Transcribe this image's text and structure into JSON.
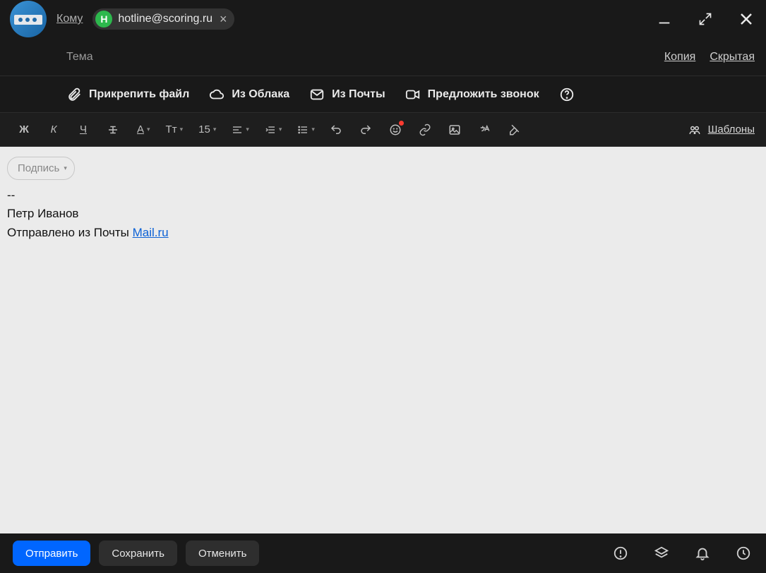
{
  "header": {
    "to_label": "Кому",
    "recipient": {
      "initial": "Н",
      "email": "hotline@scoring.ru"
    }
  },
  "subject": {
    "placeholder": "Тема",
    "cc_label": "Копия",
    "bcc_label": "Скрытая"
  },
  "attach": {
    "file": "Прикрепить файл",
    "cloud": "Из Облака",
    "mail": "Из Почты",
    "call": "Предложить звонок"
  },
  "toolbar": {
    "font_size": "15",
    "templates": "Шаблоны"
  },
  "editor": {
    "signature_label": "Подпись",
    "sig_sep": "--",
    "sig_name": "Петр Иванов",
    "sig_sent_prefix": "Отправлено из Почты ",
    "sig_link_text": "Mail.ru"
  },
  "footer": {
    "send": "Отправить",
    "save": "Сохранить",
    "cancel": "Отменить"
  }
}
